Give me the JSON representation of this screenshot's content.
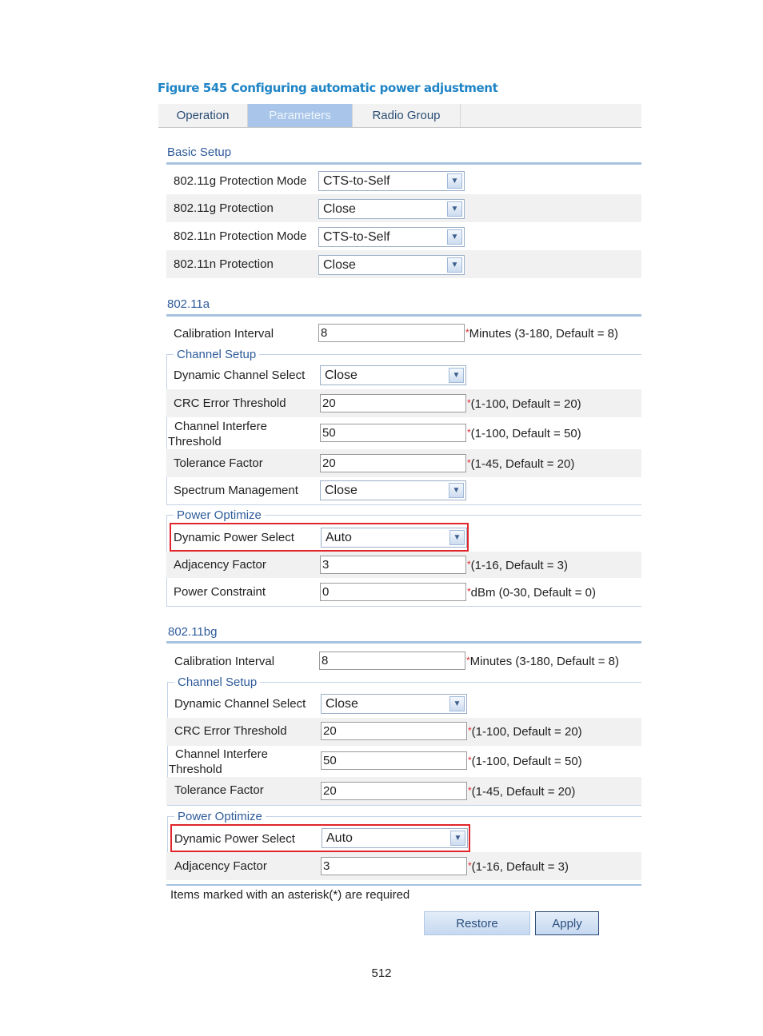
{
  "figure_title": "Figure 545 Configuring automatic power adjustment",
  "tabs": [
    {
      "label": "Operation",
      "active": false
    },
    {
      "label": "Parameters",
      "active": true
    },
    {
      "label": "Radio Group",
      "active": false
    }
  ],
  "basic_setup": {
    "title": "Basic Setup",
    "rows": [
      {
        "label": "802.11g Protection Mode",
        "value": "CTS-to-Self"
      },
      {
        "label": "802.11g Protection",
        "value": "Close"
      },
      {
        "label": "802.11n Protection Mode",
        "value": "CTS-to-Self"
      },
      {
        "label": "802.11n Protection",
        "value": "Close"
      }
    ]
  },
  "a": {
    "title": "802.11a",
    "calibration_label": "Calibration Interval",
    "calibration_value": "8",
    "calibration_hint": "Minutes (3-180, Default = 8)",
    "channel_setup_legend": "Channel Setup",
    "dynamic_channel_label": "Dynamic Channel Select",
    "dynamic_channel_value": "Close",
    "crc_label": "CRC Error Threshold",
    "crc_value": "20",
    "crc_hint": "(1-100, Default = 20)",
    "interfere_label_1": "Channel Interfere",
    "interfere_label_2": "Threshold",
    "interfere_value": "50",
    "interfere_hint": "(1-100, Default = 50)",
    "tolerance_label": "Tolerance Factor",
    "tolerance_value": "20",
    "tolerance_hint": "(1-45, Default = 20)",
    "spectrum_label": "Spectrum Management",
    "spectrum_value": "Close",
    "power_legend": "Power Optimize",
    "dps_label": "Dynamic Power Select",
    "dps_value": "Auto",
    "adjacency_label": "Adjacency Factor",
    "adjacency_value": "3",
    "adjacency_hint": "(1-16, Default = 3)",
    "constraint_label": "Power Constraint",
    "constraint_value": "0",
    "constraint_hint": "dBm (0-30, Default = 0)"
  },
  "bg": {
    "title": "802.11bg",
    "calibration_label": "Calibration Interval",
    "calibration_value": "8",
    "calibration_hint": "Minutes (3-180, Default = 8)",
    "channel_setup_legend": "Channel Setup",
    "dynamic_channel_label": "Dynamic Channel Select",
    "dynamic_channel_value": "Close",
    "crc_label": "CRC Error Threshold",
    "crc_value": "20",
    "crc_hint": "(1-100, Default = 20)",
    "interfere_label_1": "Channel Interfere",
    "interfere_label_2": "Threshold",
    "interfere_value": "50",
    "interfere_hint": "(1-100, Default = 50)",
    "tolerance_label": "Tolerance Factor",
    "tolerance_value": "20",
    "tolerance_hint": "(1-45, Default = 20)",
    "power_legend": "Power Optimize",
    "dps_label": "Dynamic Power Select",
    "dps_value": "Auto",
    "adjacency_label": "Adjacency Factor",
    "adjacency_value": "3",
    "adjacency_hint": "(1-16, Default = 3)"
  },
  "asterisk": "*",
  "dropdown_arrow": "▼",
  "footer_note": "Items marked with an asterisk(*) are required",
  "buttons": {
    "restore": "Restore",
    "apply": "Apply"
  },
  "page_number": "512"
}
